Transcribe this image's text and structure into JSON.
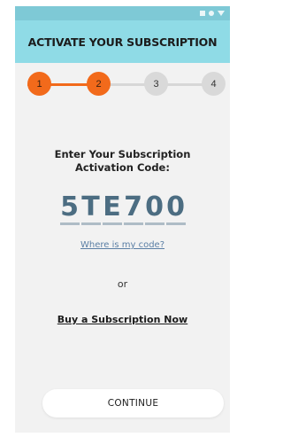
{
  "header": {
    "title": "ACTIVATE YOUR SUBSCRIPTION"
  },
  "status_bar": {
    "icons": [
      "signal-square-icon",
      "wifi-dot-icon",
      "battery-triangle-icon"
    ]
  },
  "stepper": {
    "steps": [
      {
        "label": "1",
        "state": "active"
      },
      {
        "label": "2",
        "state": "active"
      },
      {
        "label": "3",
        "state": "inactive"
      },
      {
        "label": "4",
        "state": "inactive"
      }
    ],
    "active_color": "#f26a1b",
    "inactive_color": "#d9d9d9"
  },
  "prompt": {
    "line1": "Enter Your Subscription",
    "line2": "Activation Code:"
  },
  "code": {
    "chars": [
      "5",
      "T",
      "E",
      "7",
      "0",
      "0"
    ]
  },
  "links": {
    "where_code": "Where is my code?",
    "or": "or",
    "buy": "Buy a Subscription Now"
  },
  "buttons": {
    "continue": "CONTINUE"
  },
  "colors": {
    "header_bg": "#8fdbe6",
    "status_bar_bg": "#7ec9d6",
    "code_text": "#4c6d82",
    "link": "#5b7fa5"
  }
}
